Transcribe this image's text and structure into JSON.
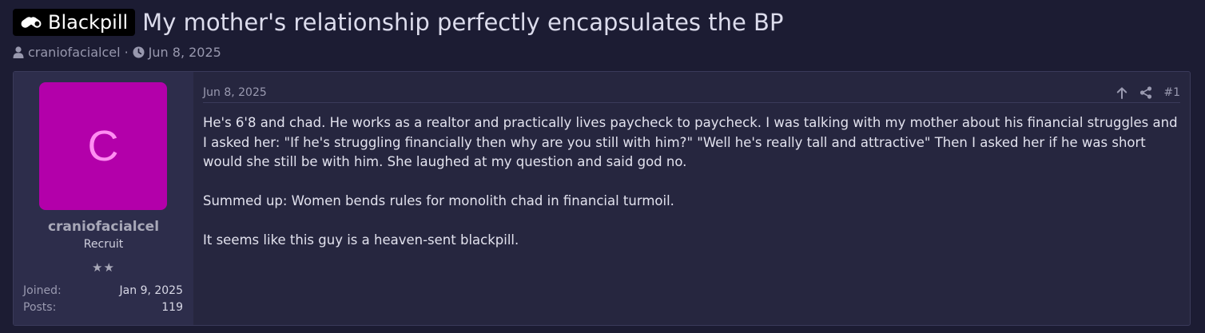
{
  "thread": {
    "prefix": "Blackpill",
    "title": "My mother's relationship perfectly encapsulates the BP",
    "author": "craniofacialcel",
    "separator": "·",
    "date": "Jun 8, 2025"
  },
  "post": {
    "date": "Jun 8, 2025",
    "number": "#1",
    "paragraphs": [
      "He's 6'8 and chad. He works as a realtor and practically lives paycheck to paycheck. I was talking with my mother about his financial struggles and I asked her: \"If he's struggling financially then why are you still with him?\" \"Well he's really tall and attractive\" Then I asked her if he was short would she still be with him. She laughed at my question and said god no.",
      "Summed up: Women bends rules for monolith chad in financial turmoil.",
      "It seems like this guy is a heaven-sent blackpill."
    ]
  },
  "user": {
    "avatar_letter": "C",
    "name": "craniofacialcel",
    "title": "Recruit",
    "stars": "★★",
    "joined_label": "Joined:",
    "joined_value": "Jan 9, 2025",
    "posts_label": "Posts:",
    "posts_value": "119"
  },
  "icons": {
    "prefix": "pill-icon",
    "author": "user-icon",
    "date": "clock-icon",
    "up": "arrow-up-icon",
    "share": "share-icon"
  },
  "colors": {
    "background": "#1c1c33",
    "post_background": "#26263f",
    "user_panel": "#2d2d4b",
    "avatar": "#b300aa",
    "avatar_letter": "#ff8ef2"
  }
}
